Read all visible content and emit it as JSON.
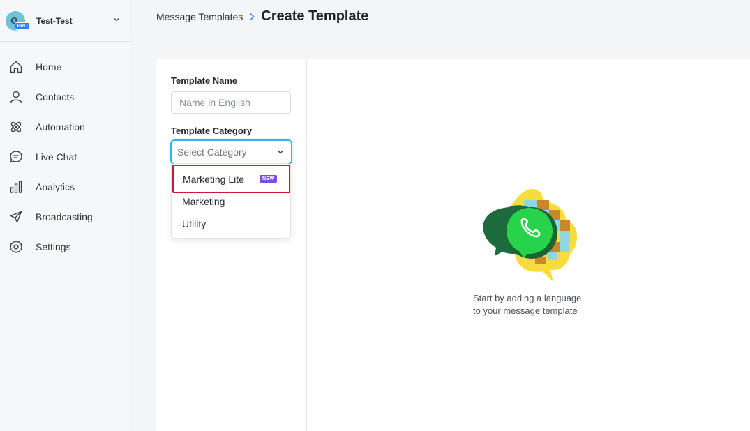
{
  "workspace": {
    "avatar_letter": "o",
    "badge": "PRO",
    "name": "Test-Test",
    "chevron_icon": "chevron-down-icon"
  },
  "sidebar": {
    "items": [
      {
        "label": "Home",
        "icon": "home-icon"
      },
      {
        "label": "Contacts",
        "icon": "user-icon"
      },
      {
        "label": "Automation",
        "icon": "atom-icon"
      },
      {
        "label": "Live Chat",
        "icon": "chat-icon"
      },
      {
        "label": "Analytics",
        "icon": "bar-chart-icon"
      },
      {
        "label": "Broadcasting",
        "icon": "send-icon"
      },
      {
        "label": "Settings",
        "icon": "gear-icon"
      }
    ]
  },
  "header": {
    "breadcrumb_parent": "Message Templates",
    "title": "Create Template"
  },
  "form": {
    "name_label": "Template Name",
    "name_value": "",
    "name_placeholder": "Name in English",
    "category_label": "Template Category",
    "category_placeholder": "Select Category",
    "category_options": [
      {
        "label": "Marketing Lite",
        "badge": "NEW",
        "highlighted": true
      },
      {
        "label": "Marketing"
      },
      {
        "label": "Utility"
      }
    ]
  },
  "empty_state": {
    "line1": "Start by adding a language",
    "line2": "to your message template"
  },
  "colors": {
    "accent_blue": "#3bb3e8",
    "highlight_red": "#d0193a",
    "new_badge": "#7a4fe0",
    "pro_badge": "#2d7ff9",
    "whatsapp_green": "#25d366"
  }
}
